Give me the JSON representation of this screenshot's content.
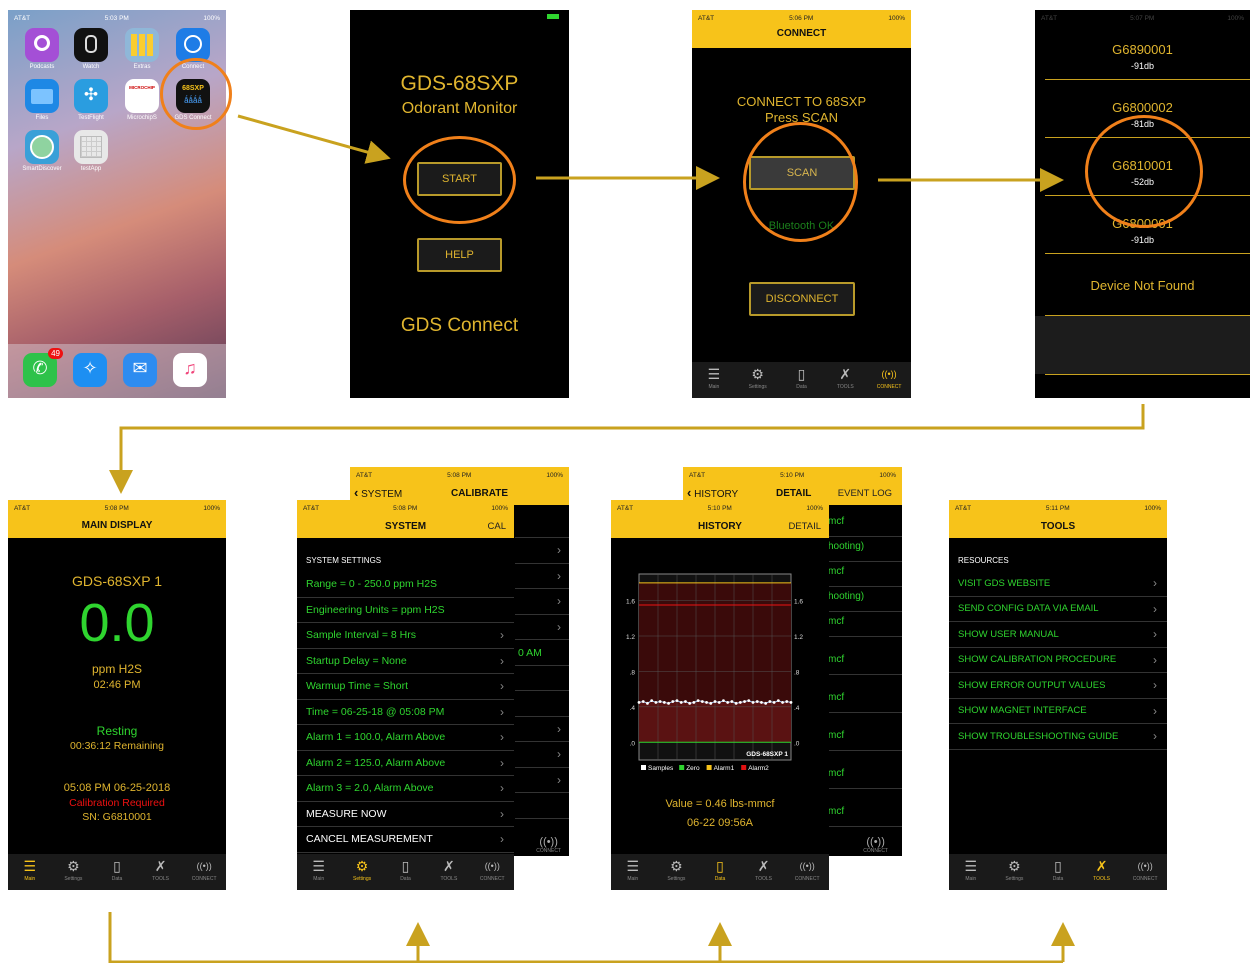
{
  "screen1": {
    "status": {
      "carrier": "AT&T",
      "time": "5:03 PM",
      "battery": "100%"
    },
    "apps": [
      {
        "label": "Podcasts",
        "icon": "podcasts-icon",
        "color": "#a44fd6"
      },
      {
        "label": "Watch",
        "icon": "watch-icon",
        "color": "#111111"
      },
      {
        "label": "Extras",
        "icon": "extras-folder-icon",
        "color": "#8fb7d8"
      },
      {
        "label": "Connect",
        "icon": "connect-icon",
        "color": "#1e7ce6"
      },
      {
        "label": "Files",
        "icon": "files-icon",
        "color": "#1e88e5"
      },
      {
        "label": "TestFlight",
        "icon": "testflight-icon",
        "color": "#2a9de0"
      },
      {
        "label": "MicrochipS",
        "icon": "microchip-icon",
        "color": "#ffffff"
      },
      {
        "label": "GDS Connect",
        "icon": "gds-connect-icon",
        "color": "#111111"
      },
      {
        "label": "SmartDiscover",
        "icon": "smartdiscover-icon",
        "color": "#3aa0d8"
      },
      {
        "label": "testApp",
        "icon": "testapp-icon",
        "color": "#e8e8e8"
      }
    ],
    "gds_tile": {
      "top": "68SXP",
      "bottom": "ǻǻǻǻ"
    },
    "microchip_tile": "MICROCHIP",
    "dock": [
      {
        "icon": "phone-icon",
        "color": "#2ec24a",
        "badge": "49"
      },
      {
        "icon": "safari-icon",
        "color": "#1d8ff2"
      },
      {
        "icon": "mail-icon",
        "color": "#2d8cf0"
      },
      {
        "icon": "music-icon",
        "color": "#ffffff"
      }
    ]
  },
  "screen2": {
    "title": "GDS-68SXP",
    "subtitle": "Odorant Monitor",
    "start": "START",
    "help": "HELP",
    "footer": "GDS Connect"
  },
  "screen3": {
    "status": {
      "carrier": "AT&T",
      "time": "5:06 PM",
      "battery": "100%"
    },
    "header": "CONNECT",
    "line1": "CONNECT TO 68SXP",
    "line2": "Press SCAN",
    "scan": "SCAN",
    "bt": "Bluetooth OK",
    "disconnect": "DISCONNECT"
  },
  "screen4": {
    "status": {
      "carrier": "AT&T",
      "time": "5:07 PM",
      "battery": "100%"
    },
    "devices": [
      {
        "name": "G6890001",
        "rssi": "-91db"
      },
      {
        "name": "G6800002",
        "rssi": "-81db"
      },
      {
        "name": "G6810001",
        "rssi": "-52db"
      },
      {
        "name": "G6800001",
        "rssi": "-91db"
      }
    ],
    "not_found": "Device Not Found"
  },
  "tabs": [
    "Main",
    "Settings",
    "Data",
    "TOOLS",
    "CONNECT"
  ],
  "screen5": {
    "status": {
      "carrier": "AT&T",
      "time": "5:08 PM",
      "battery": "100%"
    },
    "header": "MAIN DISPLAY",
    "device": "GDS-68SXP 1",
    "value": "0.0",
    "unit": "ppm H2S",
    "time": "02:46 PM",
    "state": "Resting",
    "remaining": "00:36:12 Remaining",
    "datetime": "05:08 PM   06-25-2018",
    "calib": "Calibration Required",
    "sn": "SN: G6810001"
  },
  "screen6": {
    "back": {
      "status": {
        "carrier": "AT&T",
        "time": "5:08 PM",
        "battery": "100%"
      },
      "back_label": "SYSTEM",
      "title": "CALIBRATE",
      "row_fragment": "0 AM"
    },
    "status": {
      "carrier": "AT&T",
      "time": "5:08 PM",
      "battery": "100%"
    },
    "header": "SYSTEM",
    "right": "CAL",
    "section": "SYSTEM SETTINGS",
    "rows": [
      {
        "text": "Range = 0 - 250.0 ppm H2S",
        "color": "green",
        "chev": false
      },
      {
        "text": "Engineering Units = ppm H2S",
        "color": "green",
        "chev": false
      },
      {
        "text": "Sample Interval = 8 Hrs",
        "color": "green",
        "chev": true
      },
      {
        "text": "Startup Delay = None",
        "color": "green",
        "chev": true
      },
      {
        "text": "Warmup Time = Short",
        "color": "green",
        "chev": true
      },
      {
        "text": "Time = 06-25-18 @ 05:08 PM",
        "color": "green",
        "chev": true
      },
      {
        "text": "Alarm 1 = 100.0, Alarm Above",
        "color": "green",
        "chev": true
      },
      {
        "text": "Alarm 2 = 125.0, Alarm Above",
        "color": "green",
        "chev": true
      },
      {
        "text": "Alarm 3 = 2.0, Alarm Above",
        "color": "green",
        "chev": true
      },
      {
        "text": "MEASURE NOW",
        "color": "white",
        "chev": true
      },
      {
        "text": "CANCEL MEASUREMENT",
        "color": "white",
        "chev": true
      }
    ]
  },
  "screen7": {
    "back": {
      "status": {
        "carrier": "AT&T",
        "time": "5:10 PM",
        "battery": "100%"
      },
      "back_label": "HISTORY",
      "title": "DETAIL",
      "right": "EVENT LOG",
      "items": [
        "mcf",
        "hooting)",
        "mcf",
        "hooting)",
        "mcf",
        "mcf",
        "mcf",
        "mcf",
        "mcf",
        "mcf"
      ]
    },
    "status": {
      "carrier": "AT&T",
      "time": "5:10 PM",
      "battery": "100%"
    },
    "header": "HISTORY",
    "right": "DETAIL",
    "value": "Value = 0.46 lbs-mmcf",
    "datetime": "06-22  09:56A",
    "chart_label": "GDS-68SXP 1",
    "legend": [
      {
        "name": "Samples",
        "color": "#ffffff"
      },
      {
        "name": "Zero",
        "color": "#2fd52f"
      },
      {
        "name": "Alarm1",
        "color": "#f7c31a"
      },
      {
        "name": "Alarm2",
        "color": "#e11111"
      }
    ]
  },
  "chart_data": {
    "type": "line",
    "title": "",
    "yticks": [
      "1.6",
      "1.2",
      ".8",
      ".4",
      ".0"
    ],
    "ylim": [
      -0.2,
      1.9
    ],
    "series": [
      {
        "name": "Samples",
        "values": [
          0.45,
          0.46,
          0.44,
          0.47,
          0.45,
          0.46,
          0.45,
          0.44,
          0.46,
          0.47,
          0.45,
          0.46,
          0.44,
          0.45,
          0.47,
          0.46,
          0.45,
          0.44,
          0.46,
          0.45,
          0.47,
          0.45,
          0.46,
          0.44,
          0.45,
          0.46,
          0.47,
          0.45,
          0.46,
          0.45,
          0.44,
          0.46,
          0.45,
          0.47,
          0.45,
          0.46,
          0.45
        ]
      },
      {
        "name": "Zero",
        "values": [
          0,
          0
        ]
      },
      {
        "name": "Alarm1",
        "values": [
          1.8,
          1.8
        ]
      },
      {
        "name": "Alarm2",
        "values": [
          1.55,
          1.55
        ]
      }
    ],
    "grid": true
  },
  "screen8": {
    "status": {
      "carrier": "AT&T",
      "time": "5:11 PM",
      "battery": "100%"
    },
    "header": "TOOLS",
    "section": "RESOURCES",
    "rows": [
      "VISIT GDS WEBSITE",
      "SEND CONFIG DATA VIA EMAIL",
      "SHOW USER MANUAL",
      "SHOW CALIBRATION PROCEDURE",
      "SHOW ERROR OUTPUT VALUES",
      "SHOW MAGNET INTERFACE",
      "SHOW TROUBLESHOOTING GUIDE"
    ]
  },
  "colors": {
    "accent": "#f7c31a",
    "highlight": "#f0801a",
    "arrow": "#c9a21f",
    "value_green": "#2fd52f"
  }
}
